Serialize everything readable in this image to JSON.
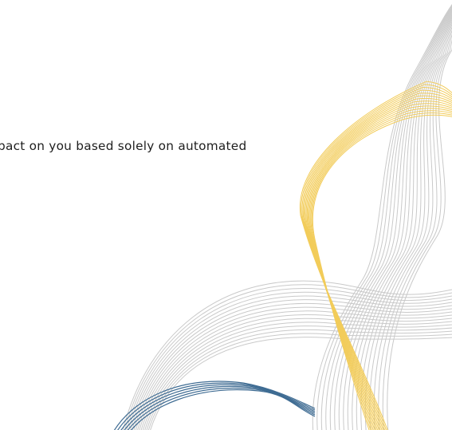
{
  "document": {
    "body_text": "pact on you based solely on automated"
  },
  "decoration": {
    "colors": {
      "grey_lines": "#c9c9c9",
      "gold_lines": "#f2cc5a",
      "blue_lines": "#3f6c93"
    }
  }
}
